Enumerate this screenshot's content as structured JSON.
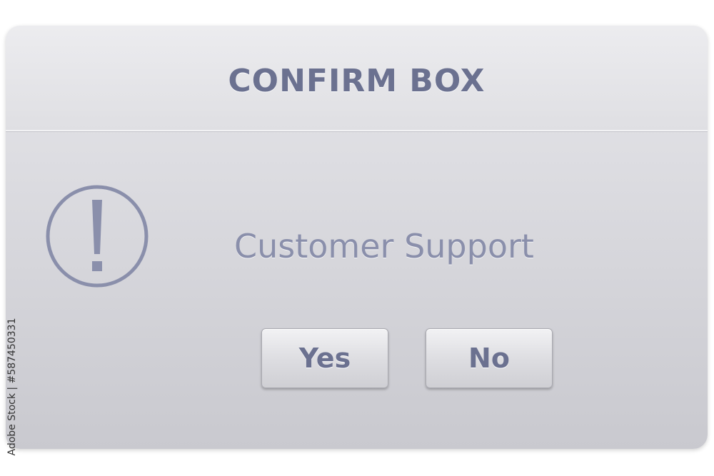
{
  "dialog": {
    "title": "CONFIRM BOX",
    "icon": "exclamation-circle-icon",
    "message": "Customer Support",
    "buttons": {
      "yes_label": "Yes",
      "no_label": "No"
    }
  },
  "watermark": {
    "text": "Adobe Stock | #587450331"
  },
  "colors": {
    "text": "#6b7190",
    "message_text": "#8a8fab",
    "panel": "#d9d9de"
  }
}
